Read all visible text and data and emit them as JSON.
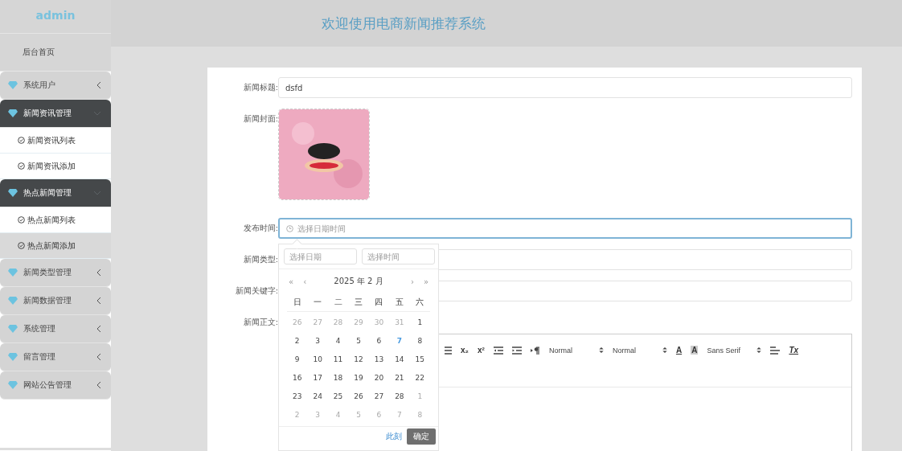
{
  "sidebar": {
    "brand": "admin",
    "items": [
      {
        "kind": "link",
        "label": "后台首页"
      },
      {
        "kind": "group",
        "label": "系统用户",
        "expanded": false
      },
      {
        "kind": "group",
        "label": "新闻资讯管理",
        "expanded": true,
        "children": [
          {
            "label": "新闻资讯列表",
            "selected": false
          },
          {
            "label": "新闻资讯添加",
            "selected": false
          }
        ]
      },
      {
        "kind": "group",
        "label": "热点新闻管理",
        "expanded": true,
        "children": [
          {
            "label": "热点新闻列表",
            "selected": false
          },
          {
            "label": "热点新闻添加",
            "selected": true
          }
        ]
      },
      {
        "kind": "group",
        "label": "新闻类型管理",
        "expanded": false
      },
      {
        "kind": "group",
        "label": "新闻数据管理",
        "expanded": false
      },
      {
        "kind": "group",
        "label": "系统管理",
        "expanded": false
      },
      {
        "kind": "group",
        "label": "留言管理",
        "expanded": false
      },
      {
        "kind": "group",
        "label": "网站公告管理",
        "expanded": false
      }
    ]
  },
  "header": {
    "title": "欢迎使用电商新闻推荐系统"
  },
  "form": {
    "fields": [
      {
        "kind": "text",
        "label": "新闻标题:",
        "value": "dsfd",
        "focused": false
      },
      {
        "label": "新闻封面:"
      },
      {
        "kind": "datetime",
        "label": "发布时间:",
        "placeholder": "选择日期时间",
        "focused": true
      },
      {
        "kind": "text",
        "label": "新闻类型:",
        "focused": false
      },
      {
        "kind": "text",
        "label": "新闻关键字:",
        "focused": false
      },
      {
        "kind": "editor",
        "label": "新闻正文:"
      }
    ]
  },
  "editor": {
    "toolbar": [
      {
        "kind": "list"
      },
      {
        "kind": "glyph",
        "text": "x₂"
      },
      {
        "kind": "glyph",
        "text": "x²"
      },
      {
        "kind": "outdent"
      },
      {
        "kind": "indent"
      },
      {
        "kind": "direction"
      },
      {
        "kind": "select",
        "label": "Normal"
      },
      {
        "kind": "select",
        "label": "Normal"
      },
      {
        "kind": "color",
        "text": "A"
      },
      {
        "kind": "highlight",
        "text": "A"
      },
      {
        "kind": "select",
        "label": "Sans Serif"
      },
      {
        "kind": "align"
      },
      {
        "kind": "clear",
        "text": "Tx"
      }
    ]
  },
  "datepicker": {
    "date_placeholder": "选择日期",
    "time_placeholder": "选择时间",
    "nav": [
      "«",
      "‹",
      "›",
      "»"
    ],
    "title": "2025 年  2 月",
    "weekdays": [
      "日",
      "一",
      "二",
      "三",
      "四",
      "五",
      "六"
    ],
    "weeks": [
      [
        {
          "day": "26",
          "in_month": false,
          "today": false
        },
        {
          "day": "27",
          "in_month": false,
          "today": false
        },
        {
          "day": "28",
          "in_month": false,
          "today": false
        },
        {
          "day": "29",
          "in_month": false,
          "today": false
        },
        {
          "day": "30",
          "in_month": false,
          "today": false
        },
        {
          "day": "31",
          "in_month": false,
          "today": false
        },
        {
          "day": "1",
          "in_month": true,
          "today": false
        }
      ],
      [
        {
          "day": "2",
          "in_month": true,
          "today": false
        },
        {
          "day": "3",
          "in_month": true,
          "today": false
        },
        {
          "day": "4",
          "in_month": true,
          "today": false
        },
        {
          "day": "5",
          "in_month": true,
          "today": false
        },
        {
          "day": "6",
          "in_month": true,
          "today": false
        },
        {
          "day": "7",
          "in_month": true,
          "today": true
        },
        {
          "day": "8",
          "in_month": true,
          "today": false
        }
      ],
      [
        {
          "day": "9",
          "in_month": true,
          "today": false
        },
        {
          "day": "10",
          "in_month": true,
          "today": false
        },
        {
          "day": "11",
          "in_month": true,
          "today": false
        },
        {
          "day": "12",
          "in_month": true,
          "today": false
        },
        {
          "day": "13",
          "in_month": true,
          "today": false
        },
        {
          "day": "14",
          "in_month": true,
          "today": false
        },
        {
          "day": "15",
          "in_month": true,
          "today": false
        }
      ],
      [
        {
          "day": "16",
          "in_month": true,
          "today": false
        },
        {
          "day": "17",
          "in_month": true,
          "today": false
        },
        {
          "day": "18",
          "in_month": true,
          "today": false
        },
        {
          "day": "19",
          "in_month": true,
          "today": false
        },
        {
          "day": "20",
          "in_month": true,
          "today": false
        },
        {
          "day": "21",
          "in_month": true,
          "today": false
        },
        {
          "day": "22",
          "in_month": true,
          "today": false
        }
      ],
      [
        {
          "day": "23",
          "in_month": true,
          "today": false
        },
        {
          "day": "24",
          "in_month": true,
          "today": false
        },
        {
          "day": "25",
          "in_month": true,
          "today": false
        },
        {
          "day": "26",
          "in_month": true,
          "today": false
        },
        {
          "day": "27",
          "in_month": true,
          "today": false
        },
        {
          "day": "28",
          "in_month": true,
          "today": false
        },
        {
          "day": "1",
          "in_month": false,
          "today": false
        }
      ],
      [
        {
          "day": "2",
          "in_month": false,
          "today": false
        },
        {
          "day": "3",
          "in_month": false,
          "today": false
        },
        {
          "day": "4",
          "in_month": false,
          "today": false
        },
        {
          "day": "5",
          "in_month": false,
          "today": false
        },
        {
          "day": "6",
          "in_month": false,
          "today": false
        },
        {
          "day": "7",
          "in_month": false,
          "today": false
        },
        {
          "day": "8",
          "in_month": false,
          "today": false
        }
      ]
    ],
    "now_link": "此刻",
    "confirm": "确定"
  }
}
